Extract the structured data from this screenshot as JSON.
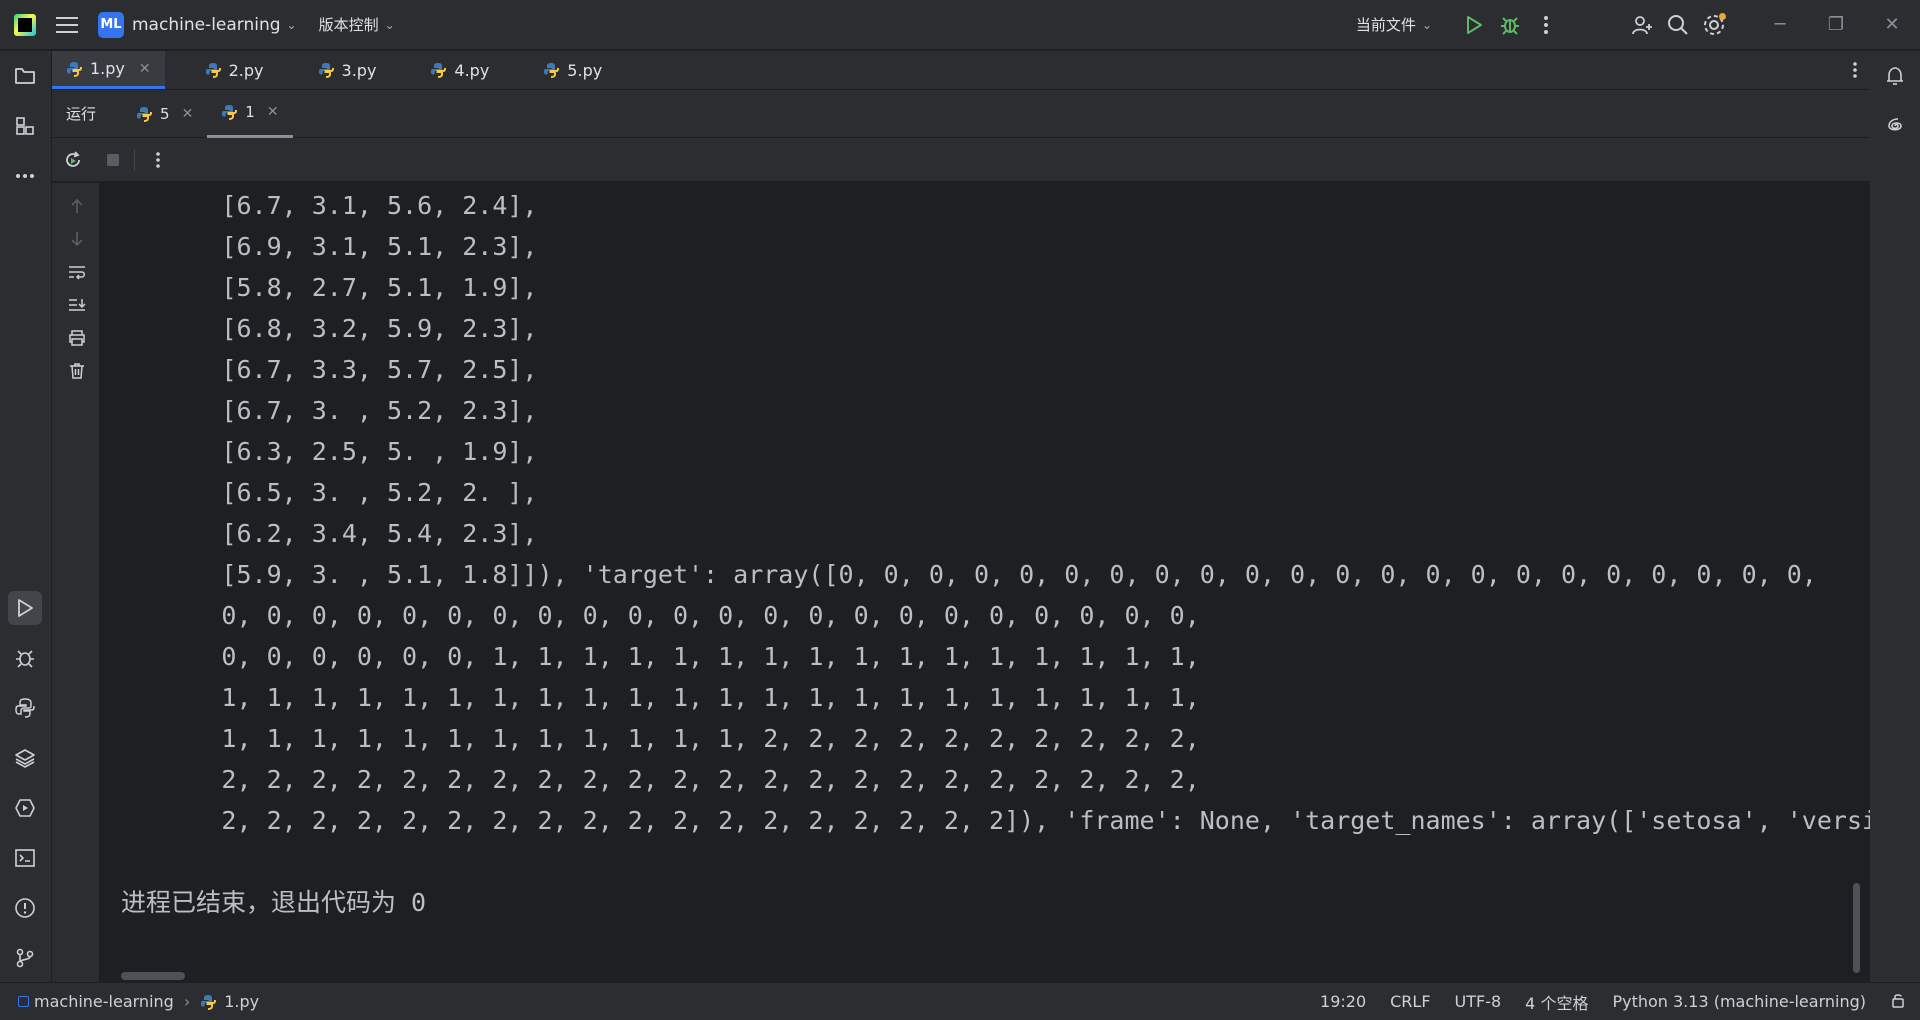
{
  "titlebar": {
    "project_badge": "ML",
    "project_name": "machine-learning",
    "vcs_label": "版本控制",
    "run_config": "当前文件"
  },
  "editor_tabs": [
    {
      "label": "1.py",
      "active": true
    },
    {
      "label": "2.py"
    },
    {
      "label": "3.py"
    },
    {
      "label": "4.py"
    },
    {
      "label": "5.py"
    }
  ],
  "run_panel": {
    "title": "运行",
    "tabs": [
      {
        "label": "5"
      },
      {
        "label": "1",
        "active": true
      }
    ]
  },
  "console": {
    "lines": [
      "        [6.7, 3.1, 5.6, 2.4],",
      "        [6.9, 3.1, 5.1, 2.3],",
      "        [5.8, 2.7, 5.1, 1.9],",
      "        [6.8, 3.2, 5.9, 2.3],",
      "        [6.7, 3.3, 5.7, 2.5],",
      "        [6.7, 3. , 5.2, 2.3],",
      "        [6.3, 2.5, 5. , 1.9],",
      "        [6.5, 3. , 5.2, 2. ],",
      "        [6.2, 3.4, 5.4, 2.3],",
      "        [5.9, 3. , 5.1, 1.8]]), 'target': array([0, 0, 0, 0, 0, 0, 0, 0, 0, 0, 0, 0, 0, 0, 0, 0, 0, 0, 0, 0, 0, 0,",
      "        0, 0, 0, 0, 0, 0, 0, 0, 0, 0, 0, 0, 0, 0, 0, 0, 0, 0, 0, 0, 0, 0,",
      "        0, 0, 0, 0, 0, 0, 1, 1, 1, 1, 1, 1, 1, 1, 1, 1, 1, 1, 1, 1, 1, 1,",
      "        1, 1, 1, 1, 1, 1, 1, 1, 1, 1, 1, 1, 1, 1, 1, 1, 1, 1, 1, 1, 1, 1,",
      "        1, 1, 1, 1, 1, 1, 1, 1, 1, 1, 1, 1, 2, 2, 2, 2, 2, 2, 2, 2, 2, 2,",
      "        2, 2, 2, 2, 2, 2, 2, 2, 2, 2, 2, 2, 2, 2, 2, 2, 2, 2, 2, 2, 2, 2,",
      "        2, 2, 2, 2, 2, 2, 2, 2, 2, 2, 2, 2, 2, 2, 2, 2, 2, 2]), 'frame': None, 'target_names': array(['setosa', 'versi"
    ],
    "exit_message": "进程已结束，退出代码为 0"
  },
  "statusbar": {
    "project": "machine-learning",
    "file": "1.py",
    "position": "19:20",
    "line_sep": "CRLF",
    "encoding": "UTF-8",
    "indent": "4 个空格",
    "interpreter": "Python 3.13 (machine-learning)"
  },
  "colors": {
    "accent": "#3574f0",
    "run_green": "#5fb865",
    "background": "#1e1f22",
    "panel": "#2b2d30"
  }
}
